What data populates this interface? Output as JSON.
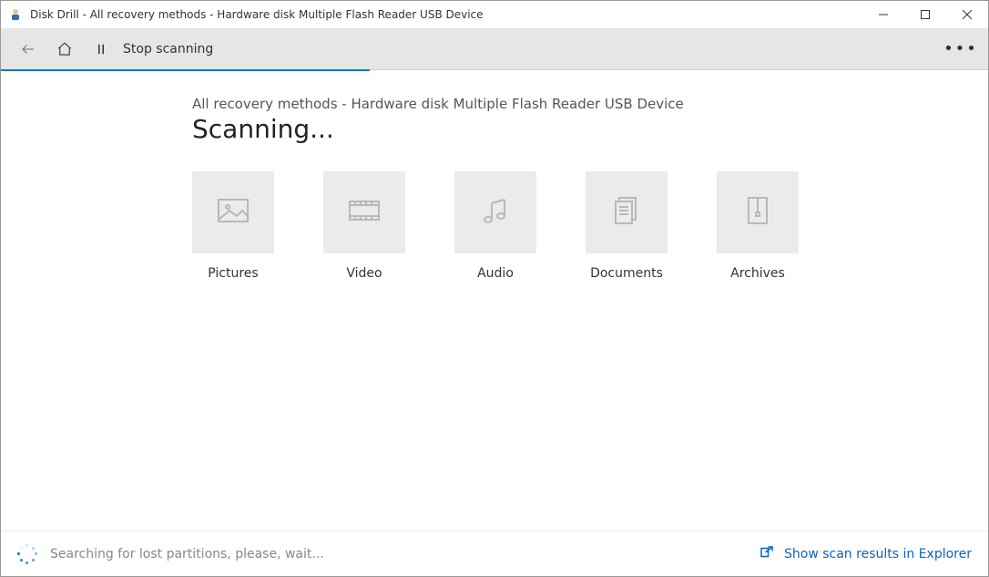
{
  "window": {
    "title": "Disk Drill - All recovery methods - Hardware disk Multiple Flash Reader USB Device"
  },
  "toolbar": {
    "stop_label": "Stop scanning"
  },
  "main": {
    "subtitle": "All recovery methods - Hardware disk Multiple Flash Reader USB Device",
    "title": "Scanning...",
    "categories": [
      {
        "label": "Pictures"
      },
      {
        "label": "Video"
      },
      {
        "label": "Audio"
      },
      {
        "label": "Documents"
      },
      {
        "label": "Archives"
      }
    ]
  },
  "status": {
    "message": "Searching for lost partitions, please, wait...",
    "explorer_link": "Show scan results in Explorer"
  }
}
